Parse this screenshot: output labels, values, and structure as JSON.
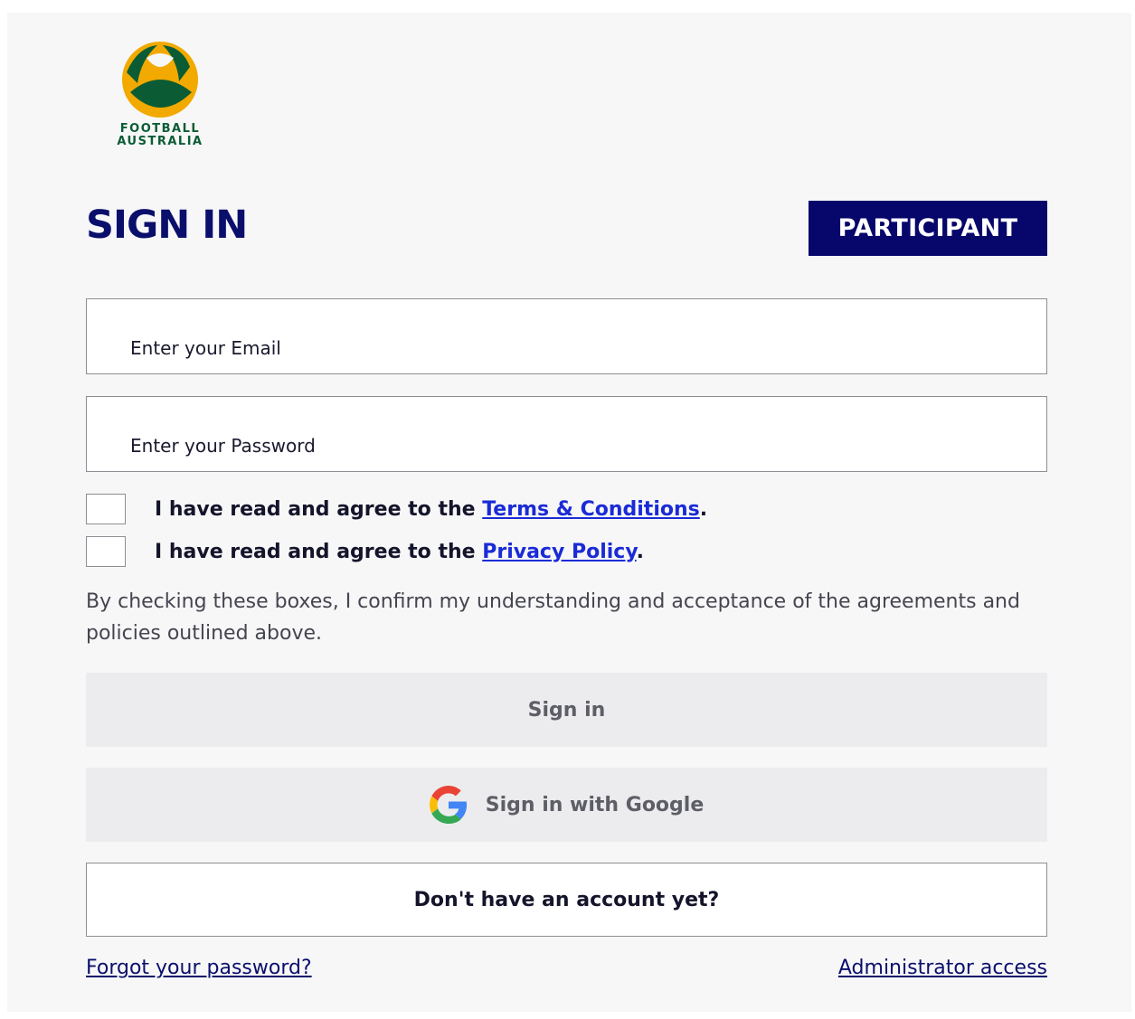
{
  "logo": {
    "line1": "FOOTBALL",
    "line2": "AUSTRALIA",
    "colors": {
      "green": "#0b5c34",
      "gold": "#f2a900"
    }
  },
  "header": {
    "title": "SIGN IN",
    "badge": "PARTICIPANT"
  },
  "form": {
    "email_placeholder": "Enter your Email",
    "password_placeholder": "Enter your Password",
    "terms": {
      "prefix": "I have read and agree to the ",
      "link": "Terms & Conditions",
      "suffix": "."
    },
    "privacy": {
      "prefix": "I have read and agree to the ",
      "link": "Privacy Policy",
      "suffix": "."
    },
    "notice": "By checking these boxes, I confirm my understanding and acceptance of the agreements and policies outlined above."
  },
  "actions": {
    "signin_label": "Sign in",
    "google_label": "Sign in with Google",
    "google_icon": "google-g-icon",
    "register_label": "Don't have an account yet?"
  },
  "footer": {
    "forgot_label": "Forgot your password?",
    "admin_label": "Administrator access"
  },
  "colors": {
    "navy": "#0a0f6b",
    "badge_bg": "#06066b",
    "link_blue": "#1a2bd6",
    "button_disabled_bg": "#ececee"
  }
}
